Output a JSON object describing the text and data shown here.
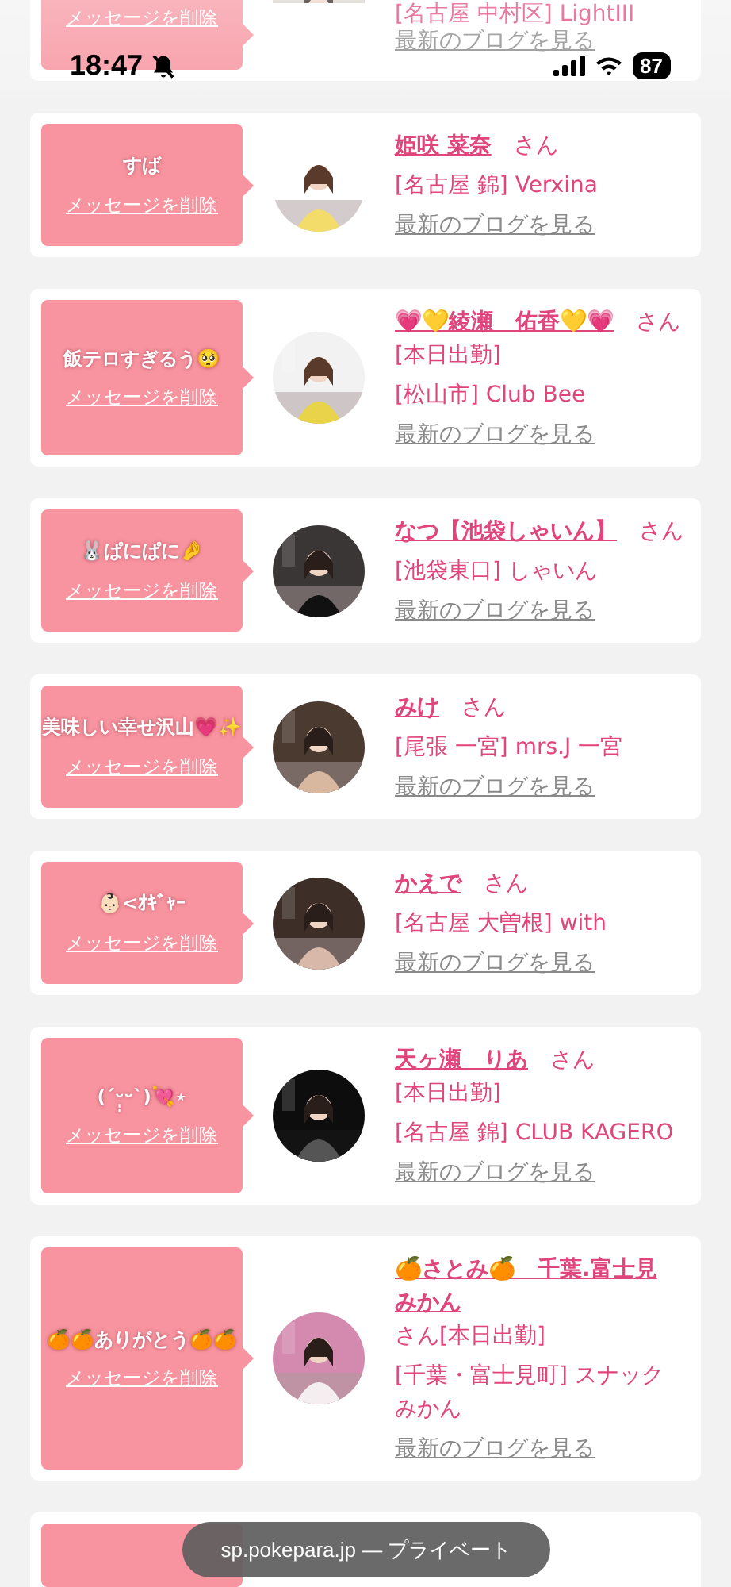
{
  "status_bar": {
    "time": "18:47",
    "battery": "87"
  },
  "messages": [
    {
      "kind": "partial",
      "delete_label": "メッセージを削除",
      "shop": "[名古屋 中村区] LightIII",
      "blog_link": "最新のブログを見る"
    },
    {
      "kind": "full",
      "message": "すば",
      "delete_label": "メッセージを削除",
      "name": "姫咲 菜奈",
      "honorific": "さん",
      "shop": "[名古屋 錦] Verxina",
      "blog_link": "最新のブログを見る"
    },
    {
      "kind": "full",
      "message": "飯テロすぎるう🥺",
      "delete_label": "メッセージを削除",
      "name": "💗💛綾瀬　佑香💛💗",
      "honorific": "さん",
      "note": "[本日出勤]",
      "shop": "[松山市] Club Bee",
      "blog_link": "最新のブログを見る"
    },
    {
      "kind": "full",
      "message": "🐰ぱにぱに🤌",
      "delete_label": "メッセージを削除",
      "name": "なつ【池袋しゃいん】",
      "honorific": "さん",
      "shop": "[池袋東口] しゃいん",
      "blog_link": "最新のブログを見る"
    },
    {
      "kind": "full",
      "message": "美味しい幸せ沢山💗✨",
      "delete_label": "メッセージを削除",
      "name": "みけ",
      "honorific": "さん",
      "shop": "[尾張 一宮] mrs.J 一宮",
      "blog_link": "最新のブログを見る"
    },
    {
      "kind": "full",
      "message": "👶🏻<ｵｷﾞｬｰ",
      "delete_label": "メッセージを削除",
      "name": "かえで",
      "honorific": "さん",
      "shop": "[名古屋 大曽根] with",
      "blog_link": "最新のブログを見る"
    },
    {
      "kind": "full",
      "message": "(ˊᵕ̩̩ᵕˋ)💘⋆",
      "delete_label": "メッセージを削除",
      "name": "天ヶ瀬　りあ",
      "honorific": "さん",
      "note": "[本日出勤]",
      "shop": "[名古屋 錦] CLUB KAGERO",
      "blog_link": "最新のブログを見る"
    },
    {
      "kind": "full",
      "message": "🍊🍊ありがとう🍊🍊",
      "delete_label": "メッセージを削除",
      "name": "🍊さとみ🍊　千葉.富士見みかん",
      "honorific": "さん",
      "note": "[本日出勤]",
      "shop": "[千葉・富士見町] スナックみかん",
      "blog_link": "最新のブログを見る"
    },
    {
      "kind": "stub"
    }
  ],
  "browser_bar": {
    "address": "sp.pokepara.jp — プライベート"
  }
}
